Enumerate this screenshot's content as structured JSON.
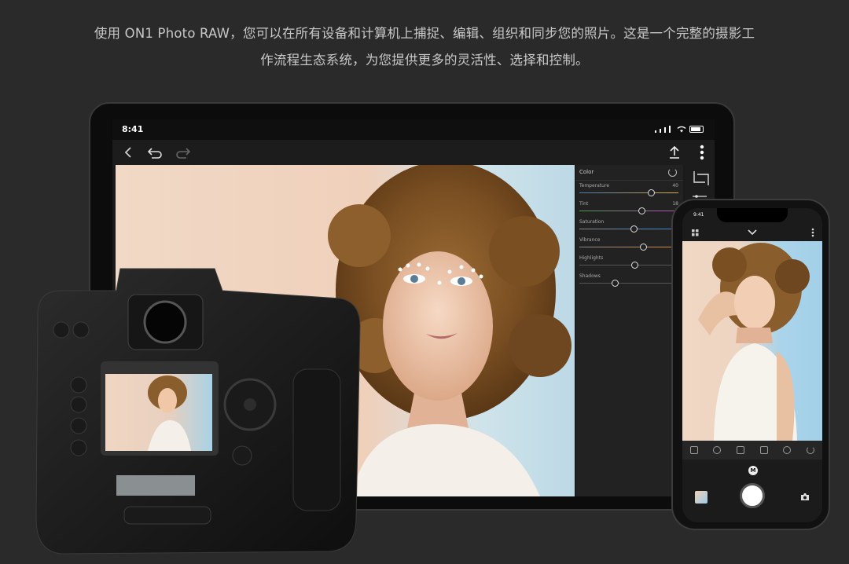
{
  "headline": {
    "line1": "使用 ON1 Photo RAW，您可以在所有设备和计算机上捕捉、编辑、组织和同步您的照片。这是一个完整的摄影工",
    "line2": "作流程生态系统，为您提供更多的灵活性、选择和控制。"
  },
  "tablet": {
    "status_time": "8:41",
    "panel": {
      "title": "Color",
      "sliders": [
        {
          "label": "Temperature",
          "value": "40",
          "position": 0.73
        },
        {
          "label": "Tint",
          "value": "18",
          "position": 0.63
        },
        {
          "label": "Saturation",
          "value": "",
          "position": 0.55
        },
        {
          "label": "Vibrance",
          "value": "",
          "position": 0.65
        },
        {
          "label": "Highlights",
          "value": "",
          "position": 0.56
        },
        {
          "label": "Shadows",
          "value": "",
          "position": 0.36
        }
      ]
    }
  },
  "phone": {
    "status_time": "9:41",
    "mode_badge": "M"
  },
  "icons": [
    "back-icon",
    "undo-icon",
    "redo-icon",
    "share-icon",
    "more-vertical-icon",
    "crop-icon",
    "adjust-sliders-icon",
    "grid-icon",
    "chevron-down-icon",
    "shutter-button",
    "flip-camera-icon"
  ],
  "colors": {
    "background": "#2a2a2a",
    "headline_text": "#c8c8c8",
    "panel": "#222222"
  }
}
